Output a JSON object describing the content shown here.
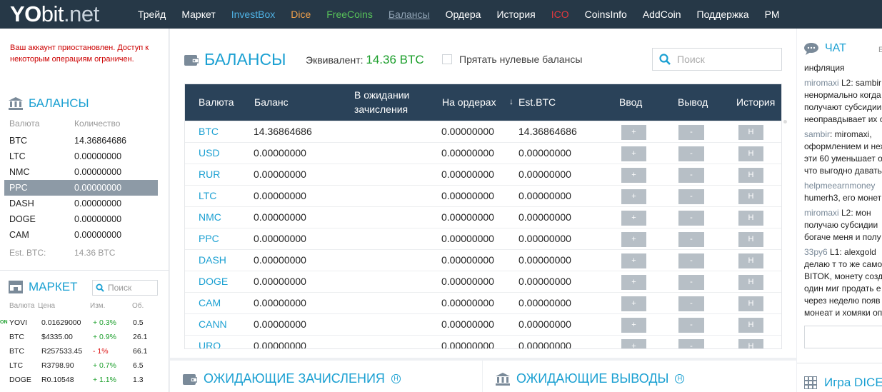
{
  "logo": {
    "yo": "YO",
    "rest": "bit",
    "dot": ".net"
  },
  "nav": [
    {
      "label": "Трейд",
      "color": "#ffffff"
    },
    {
      "label": "Маркет",
      "color": "#ffffff"
    },
    {
      "label": "InvestBox",
      "color": "#4fb3e6"
    },
    {
      "label": "Dice",
      "color": "#f0a04b"
    },
    {
      "label": "FreeCoins",
      "color": "#58c25a"
    },
    {
      "label": "Балансы",
      "color": "#8fa2b3"
    },
    {
      "label": "Ордера",
      "color": "#ffffff"
    },
    {
      "label": "История",
      "color": "#ffffff"
    },
    {
      "label": "ICO",
      "color": "#e0393e"
    },
    {
      "label": "CoinsInfo",
      "color": "#ffffff"
    },
    {
      "label": "AddCoin",
      "color": "#ffffff"
    },
    {
      "label": "Поддержка",
      "color": "#ffffff"
    },
    {
      "label": "PM",
      "color": "#ffffff"
    }
  ],
  "notice": "Ваш аккаунт приостановлен. Доступ к некоторым операциям ограничен.",
  "sidebar_balances": {
    "title": "Балансы",
    "col_currency": "Валюта",
    "col_amount": "Количество",
    "rows": [
      {
        "cur": "BTC",
        "amt": "14.36864686"
      },
      {
        "cur": "LTC",
        "amt": "0.00000000"
      },
      {
        "cur": "NMC",
        "amt": "0.00000000"
      },
      {
        "cur": "PPC",
        "amt": "0.00000000"
      },
      {
        "cur": "DASH",
        "amt": "0.00000000"
      },
      {
        "cur": "DOGE",
        "amt": "0.00000000"
      },
      {
        "cur": "CAM",
        "amt": "0.00000000"
      }
    ],
    "selected_index": 3,
    "est_label": "Est. BTC:",
    "est_value": "14.36 BTC"
  },
  "market": {
    "title": "Маркет",
    "search_placeholder": "Поиск",
    "headers": [
      "Валюта",
      "Цена",
      "Изм.",
      "Об."
    ],
    "rows": [
      {
        "tag": "ON",
        "cur": "YOVI",
        "price": "0.01629000",
        "chg": "+ 0.3%",
        "dir": "up",
        "vol": "0.5"
      },
      {
        "tag": "",
        "cur": "BTC",
        "price": "$4335.00",
        "chg": "+ 0.9%",
        "dir": "up",
        "vol": "26.1"
      },
      {
        "tag": "",
        "cur": "BTC",
        "price": "R257533.45",
        "chg": "- 1%",
        "dir": "dn",
        "vol": "66.1"
      },
      {
        "tag": "",
        "cur": "LTC",
        "price": "R3798.90",
        "chg": "+ 0.7%",
        "dir": "up",
        "vol": "6.5"
      },
      {
        "tag": "",
        "cur": "DOGE",
        "price": "R0.10548",
        "chg": "+ 1.1%",
        "dir": "up",
        "vol": "1.3"
      }
    ]
  },
  "main": {
    "title": "Балансы",
    "equiv_label": "Эквивалент:",
    "equiv_value": "14.36 BTC",
    "hide_zero_label": "Прятать нулевые балансы",
    "search_placeholder": "Поиск",
    "headers": {
      "currency": "Валюта",
      "balance": "Баланс",
      "pending_1": "В ожидании",
      "pending_2": "зачисления",
      "on_orders": "На ордерах",
      "sort_arrow": "↓",
      "est_btc": "Est.BTC",
      "deposit": "Ввод",
      "withdraw": "Вывод",
      "history": "История"
    },
    "buttons": {
      "deposit": "+",
      "withdraw": "-",
      "history": "H"
    },
    "rows": [
      {
        "cur": "BTC",
        "bal": "14.36864686",
        "orders": "0.00000000",
        "est": "14.36864686"
      },
      {
        "cur": "USD",
        "bal": "0.00000000",
        "orders": "0.00000000",
        "est": "0.00000000"
      },
      {
        "cur": "RUR",
        "bal": "0.00000000",
        "orders": "0.00000000",
        "est": "0.00000000"
      },
      {
        "cur": "LTC",
        "bal": "0.00000000",
        "orders": "0.00000000",
        "est": "0.00000000"
      },
      {
        "cur": "NMC",
        "bal": "0.00000000",
        "orders": "0.00000000",
        "est": "0.00000000"
      },
      {
        "cur": "PPC",
        "bal": "0.00000000",
        "orders": "0.00000000",
        "est": "0.00000000"
      },
      {
        "cur": "DASH",
        "bal": "0.00000000",
        "orders": "0.00000000",
        "est": "0.00000000"
      },
      {
        "cur": "DOGE",
        "bal": "0.00000000",
        "orders": "0.00000000",
        "est": "0.00000000"
      },
      {
        "cur": "CAM",
        "bal": "0.00000000",
        "orders": "0.00000000",
        "est": "0.00000000"
      },
      {
        "cur": "CANN",
        "bal": "0.00000000",
        "orders": "0.00000000",
        "est": "0.00000000"
      },
      {
        "cur": "URO",
        "bal": "0.00000000",
        "orders": "0.00000000",
        "est": "0.00000000"
      }
    ]
  },
  "pending": {
    "title": "Ожидающие зачисления",
    "help": "H"
  },
  "withdrawals": {
    "title": "Ожидающие выводы",
    "help": "H"
  },
  "chat": {
    "title": "ЧАТ",
    "extra": "E",
    "messages": [
      {
        "user": "",
        "text": "инфляция"
      },
      {
        "user": "miromaxi",
        "text": " L2: sambir",
        "more": [
          "ненормально когда",
          "получают субсидии",
          "неоправдывает их суще"
        ]
      },
      {
        "user": "sambir",
        "text": ": miromaxi,",
        "more": [
          "оформлением и нехо",
          "эти 60 уменьшает о",
          "что выгодно давать"
        ]
      },
      {
        "user": "helpmeearnmoney",
        "text": "",
        "more": [
          "humerh3, его монет"
        ]
      },
      {
        "user": "miromaxi",
        "text": " L2: мон",
        "more": [
          "получаю субсидии",
          "богаче меня и полу"
        ]
      },
      {
        "user": "33py6",
        "text": " L1: alexgold",
        "more": [
          "делаю т то же самое",
          "BITOK, монету созда",
          "один миг продать е",
          "через неделю появ",
          "монеат и хомяки оп"
        ]
      }
    ],
    "game_title": "Игра DICE"
  },
  "colors": {
    "accent": "#1ba0d2",
    "topbar": "#263847",
    "table_header": "#2a4259",
    "up": "#1a9e2a",
    "down": "#dd1111"
  }
}
